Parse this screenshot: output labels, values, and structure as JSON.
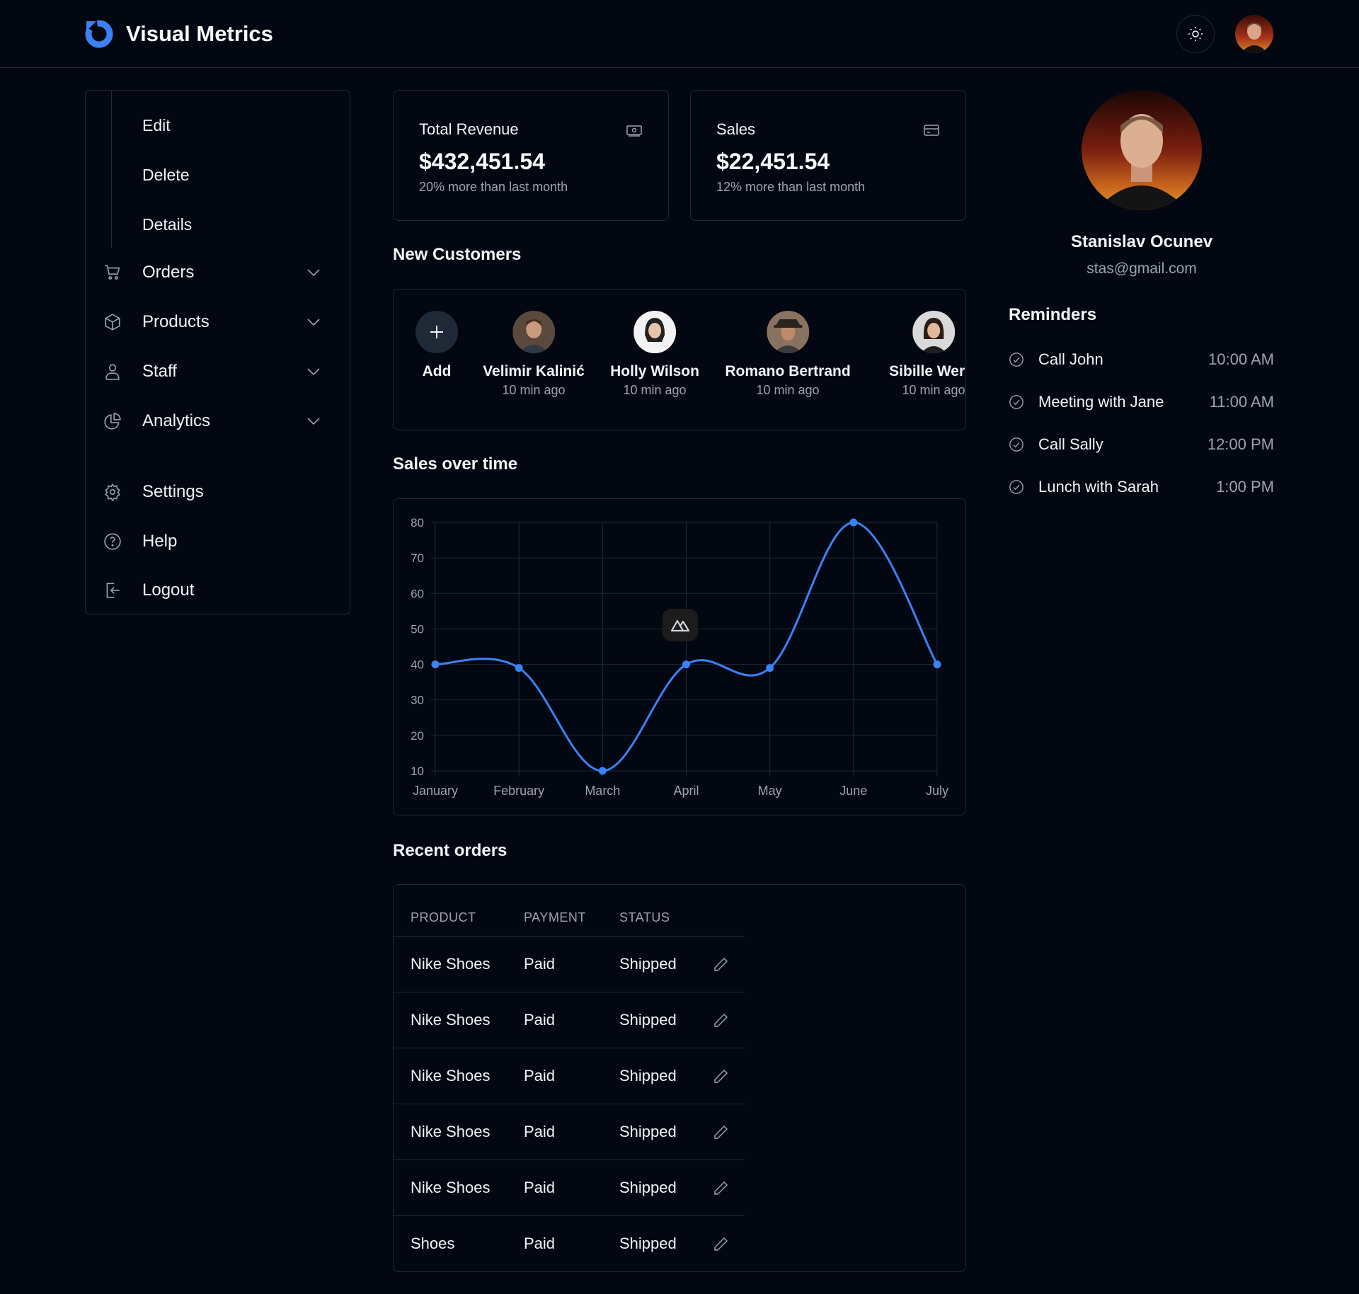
{
  "app": {
    "title": "Visual Metrics",
    "accent": "#3b82f6"
  },
  "sidebar": {
    "sub_items": [
      "Edit",
      "Delete",
      "Details"
    ],
    "items": [
      {
        "label": "Orders",
        "icon": "cart-icon",
        "expandable": true
      },
      {
        "label": "Products",
        "icon": "box-icon",
        "expandable": true
      },
      {
        "label": "Staff",
        "icon": "user-icon",
        "expandable": true
      },
      {
        "label": "Analytics",
        "icon": "pie-chart-icon",
        "expandable": true
      },
      {
        "label": "Settings",
        "icon": "gear-icon",
        "expandable": false
      },
      {
        "label": "Help",
        "icon": "help-icon",
        "expandable": false
      },
      {
        "label": "Logout",
        "icon": "logout-icon",
        "expandable": false
      }
    ]
  },
  "stats": [
    {
      "label": "Total Revenue",
      "value": "$432,451.54",
      "sub": "20% more than last month",
      "icon": "money-icon"
    },
    {
      "label": "Sales",
      "value": "$22,451.54",
      "sub": "12% more than last month",
      "icon": "credit-card-icon"
    }
  ],
  "customers": {
    "title": "New Customers",
    "add_label": "Add",
    "list": [
      {
        "name": "Velimir Kalinić",
        "time": "10 min ago"
      },
      {
        "name": "Holly Wilson",
        "time": "10 min ago"
      },
      {
        "name": "Romano Bertrand",
        "time": "10 min ago"
      },
      {
        "name": "Sibille Werni",
        "time": "10 min ago"
      }
    ]
  },
  "sales_chart": {
    "title": "Sales over time"
  },
  "chart_data": {
    "type": "line",
    "title": "Sales over time",
    "categories": [
      "January",
      "February",
      "March",
      "April",
      "May",
      "June",
      "July"
    ],
    "series": [
      {
        "values": [
          40,
          39,
          10,
          40,
          39,
          80,
          40
        ],
        "color": "#3b82f6"
      }
    ],
    "ylim": [
      10,
      80
    ],
    "yticks": [
      10,
      20,
      30,
      40,
      50,
      60,
      70,
      80
    ],
    "grid": true,
    "smooth": true
  },
  "orders": {
    "title": "Recent orders",
    "headers": [
      "PRODUCT",
      "PAYMENT",
      "STATUS"
    ],
    "rows": [
      [
        "Nike Shoes",
        "Paid",
        "Shipped"
      ],
      [
        "Nike Shoes",
        "Paid",
        "Shipped"
      ],
      [
        "Nike Shoes",
        "Paid",
        "Shipped"
      ],
      [
        "Nike Shoes",
        "Paid",
        "Shipped"
      ],
      [
        "Nike Shoes",
        "Paid",
        "Shipped"
      ],
      [
        "Shoes",
        "Paid",
        "Shipped"
      ]
    ]
  },
  "profile": {
    "name": "Stanislav Ocunev",
    "email": "stas@gmail.com"
  },
  "reminders": {
    "title": "Reminders",
    "items": [
      {
        "text": "Call John",
        "time": "10:00 AM"
      },
      {
        "text": "Meeting with Jane",
        "time": "11:00 AM"
      },
      {
        "text": "Call Sally",
        "time": "12:00 PM"
      },
      {
        "text": "Lunch with Sarah",
        "time": "1:00 PM"
      }
    ]
  }
}
